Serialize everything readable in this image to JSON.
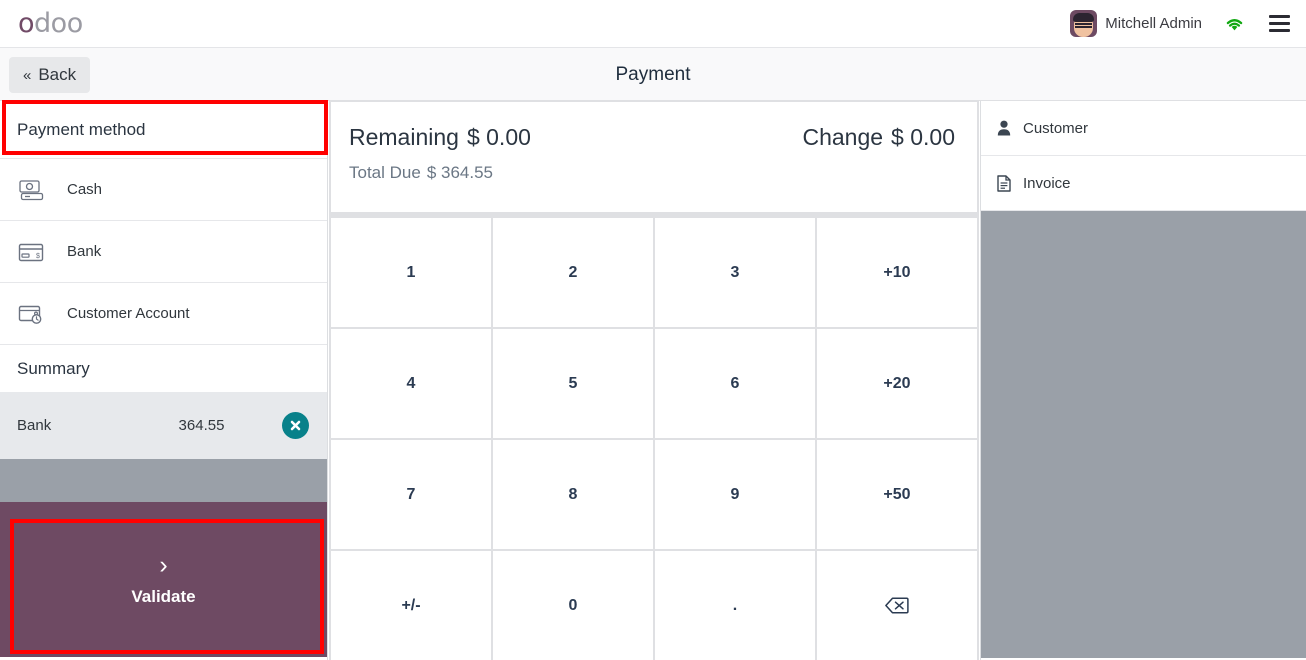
{
  "brand": {
    "logo_text": "odoo",
    "user_name": "Mitchell Admin",
    "avatar_icon": "user-avatar",
    "wifi_icon": "wifi-icon",
    "menu_icon": "hamburger-menu-icon"
  },
  "topbar": {
    "back_label": "Back",
    "back_chevron": "«",
    "title": "Payment"
  },
  "left_panel": {
    "header": "Payment method",
    "methods": [
      {
        "label": "Cash",
        "icon": "cash-icon"
      },
      {
        "label": "Bank",
        "icon": "credit-card-icon"
      },
      {
        "label": "Customer Account",
        "icon": "wallet-clock-icon"
      }
    ],
    "summary_header": "Summary",
    "payment_lines": [
      {
        "name": "Bank",
        "amount": "364.55",
        "delete_icon": "delete-circle-icon"
      }
    ],
    "validate": {
      "label": "Validate",
      "chevron": "›"
    }
  },
  "center_panel": {
    "remaining_label": "Remaining",
    "remaining_value": "$ 0.00",
    "change_label": "Change",
    "change_value": "$ 0.00",
    "total_due_label": "Total Due",
    "total_due_value": "$ 364.55",
    "numpad": [
      {
        "label": "1",
        "name": "numpad-key-1"
      },
      {
        "label": "2",
        "name": "numpad-key-2"
      },
      {
        "label": "3",
        "name": "numpad-key-3"
      },
      {
        "label": "+10",
        "name": "numpad-key-plus10"
      },
      {
        "label": "4",
        "name": "numpad-key-4"
      },
      {
        "label": "5",
        "name": "numpad-key-5"
      },
      {
        "label": "6",
        "name": "numpad-key-6"
      },
      {
        "label": "+20",
        "name": "numpad-key-plus20"
      },
      {
        "label": "7",
        "name": "numpad-key-7"
      },
      {
        "label": "8",
        "name": "numpad-key-8"
      },
      {
        "label": "9",
        "name": "numpad-key-9"
      },
      {
        "label": "+50",
        "name": "numpad-key-plus50"
      },
      {
        "label": "+/-",
        "name": "numpad-key-sign"
      },
      {
        "label": "0",
        "name": "numpad-key-0"
      },
      {
        "label": ".",
        "name": "numpad-key-decimal"
      },
      {
        "label": "",
        "name": "numpad-key-backspace",
        "icon": "backspace-icon"
      }
    ]
  },
  "right_panel": {
    "items": [
      {
        "label": "Customer",
        "icon": "person-icon"
      },
      {
        "label": "Invoice",
        "icon": "document-icon"
      }
    ]
  },
  "colors": {
    "brand_purple": "#714b67",
    "validate_bg": "#6e4a63",
    "delete_teal": "#08818a",
    "highlight_red": "#ff0000",
    "panel_gray": "#9aa0a8",
    "line_gray": "#e7e9ec"
  }
}
